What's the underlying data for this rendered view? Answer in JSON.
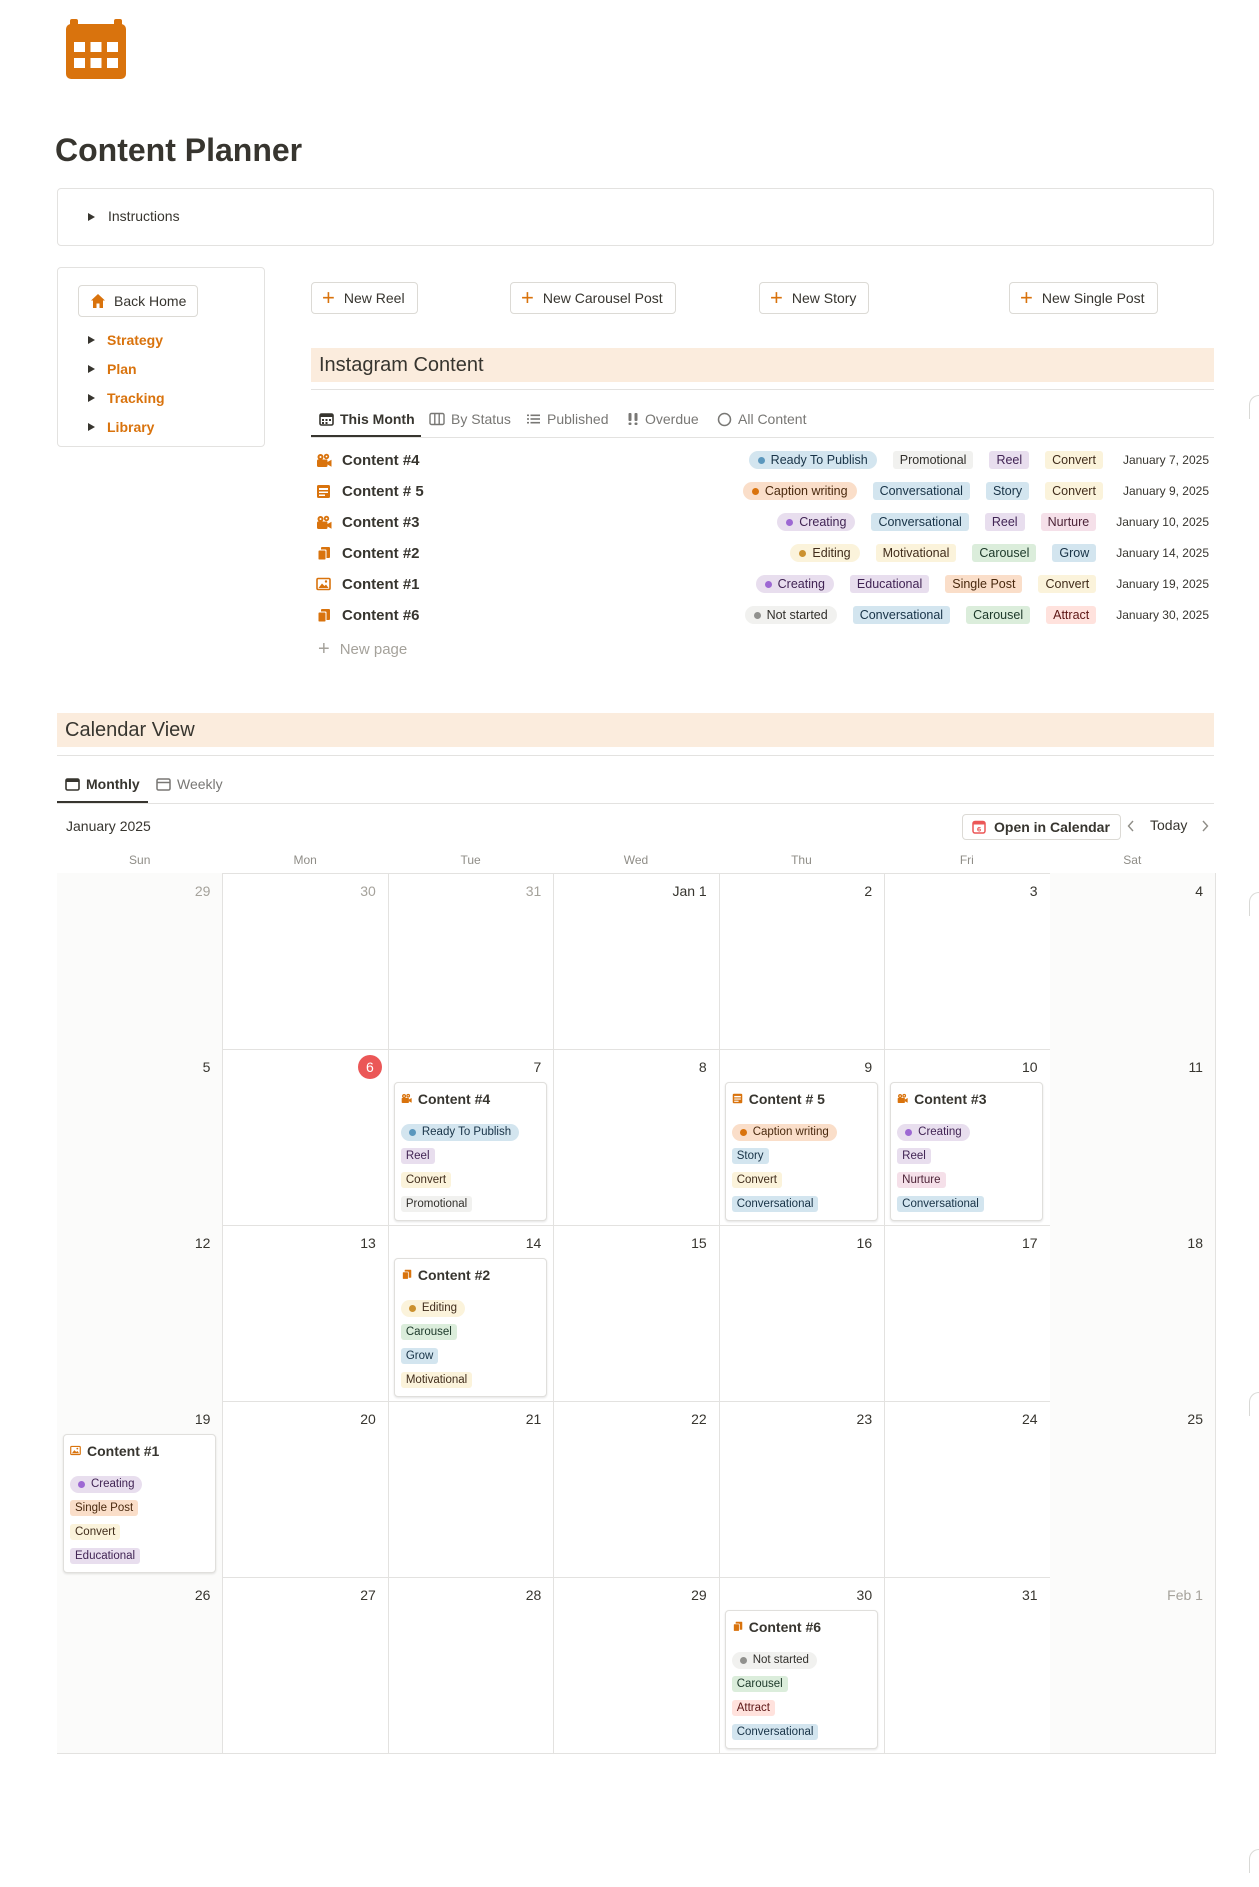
{
  "page": {
    "title": "Content Planner",
    "instructions_label": "Instructions"
  },
  "sidebar": {
    "home_label": "Back Home",
    "items": [
      "Strategy",
      "Plan",
      "Tracking",
      "Library"
    ]
  },
  "new_buttons": {
    "reel": "New Reel",
    "carousel": "New Carousel Post",
    "story": "New Story",
    "single": "New Single Post"
  },
  "instagram": {
    "heading": "Instagram Content",
    "tabs": [
      "This Month",
      "By Status",
      "Published",
      "Overdue",
      "All Content"
    ],
    "new_page_label": "New page",
    "rows": [
      {
        "name": "Content #4",
        "icon": "reel-icon",
        "status": "Ready To Publish",
        "status_color": "blue",
        "tags": [
          {
            "text": "Promotional",
            "color": "gray"
          },
          {
            "text": "Reel",
            "color": "purple"
          },
          {
            "text": "Convert",
            "color": "yellow"
          }
        ],
        "date": "January 7, 2025"
      },
      {
        "name": "Content # 5",
        "icon": "story-icon",
        "status": "Caption writing",
        "status_color": "orange",
        "tags": [
          {
            "text": "Conversational",
            "color": "blue"
          },
          {
            "text": "Story",
            "color": "blue"
          },
          {
            "text": "Convert",
            "color": "yellow"
          }
        ],
        "date": "January 9, 2025"
      },
      {
        "name": "Content #3",
        "icon": "reel-icon",
        "status": "Creating",
        "status_color": "purple",
        "tags": [
          {
            "text": "Conversational",
            "color": "blue"
          },
          {
            "text": "Reel",
            "color": "purple"
          },
          {
            "text": "Nurture",
            "color": "pink"
          }
        ],
        "date": "January 10, 2025"
      },
      {
        "name": "Content #2",
        "icon": "carousel-icon",
        "status": "Editing",
        "status_color": "yellow",
        "tags": [
          {
            "text": "Motivational",
            "color": "yellow"
          },
          {
            "text": "Carousel",
            "color": "green"
          },
          {
            "text": "Grow",
            "color": "blue"
          }
        ],
        "date": "January 14, 2025"
      },
      {
        "name": "Content #1",
        "icon": "image-icon",
        "status": "Creating",
        "status_color": "purple",
        "tags": [
          {
            "text": "Educational",
            "color": "purple"
          },
          {
            "text": "Single Post",
            "color": "orange"
          },
          {
            "text": "Convert",
            "color": "yellow"
          }
        ],
        "date": "January 19, 2025"
      },
      {
        "name": "Content #6",
        "icon": "carousel-icon",
        "status": "Not started",
        "status_color": "gray",
        "tags": [
          {
            "text": "Conversational",
            "color": "blue"
          },
          {
            "text": "Carousel",
            "color": "green"
          },
          {
            "text": "Attract",
            "color": "red"
          }
        ],
        "date": "January 30, 2025"
      }
    ]
  },
  "calendar": {
    "heading": "Calendar View",
    "tabs": [
      "Monthly",
      "Weekly"
    ],
    "month_label": "January 2025",
    "open_label": "Open in Calendar",
    "today_label": "Today",
    "weekdays": [
      "Sun",
      "Mon",
      "Tue",
      "Wed",
      "Thu",
      "Fri",
      "Sat"
    ],
    "days": [
      "29",
      "30",
      "31",
      "Jan 1",
      "2",
      "3",
      "4",
      "5",
      "6",
      "7",
      "8",
      "9",
      "10",
      "11",
      "12",
      "13",
      "14",
      "15",
      "16",
      "17",
      "18",
      "19",
      "20",
      "21",
      "22",
      "23",
      "24",
      "25",
      "26",
      "27",
      "28",
      "29",
      "30",
      "31",
      "Feb 1"
    ],
    "dim_days": [
      0,
      1,
      2,
      34
    ],
    "today_index": 8,
    "events": [
      {
        "day_index": 9,
        "title": "Content #4",
        "icon": "reel-icon",
        "status": "Ready To Publish",
        "status_color": "blue",
        "tags": [
          {
            "text": "Reel",
            "color": "purple"
          },
          {
            "text": "Convert",
            "color": "yellow"
          },
          {
            "text": "Promotional",
            "color": "gray"
          }
        ]
      },
      {
        "day_index": 11,
        "title": "Content # 5",
        "icon": "story-icon",
        "status": "Caption writing",
        "status_color": "orange",
        "tags": [
          {
            "text": "Story",
            "color": "blue"
          },
          {
            "text": "Convert",
            "color": "yellow"
          },
          {
            "text": "Conversational",
            "color": "blue"
          }
        ]
      },
      {
        "day_index": 12,
        "title": "Content #3",
        "icon": "reel-icon",
        "status": "Creating",
        "status_color": "purple",
        "tags": [
          {
            "text": "Reel",
            "color": "purple"
          },
          {
            "text": "Nurture",
            "color": "pink"
          },
          {
            "text": "Conversational",
            "color": "blue"
          }
        ]
      },
      {
        "day_index": 16,
        "title": "Content #2",
        "icon": "carousel-icon",
        "status": "Editing",
        "status_color": "yellow",
        "tags": [
          {
            "text": "Carousel",
            "color": "green"
          },
          {
            "text": "Grow",
            "color": "blue"
          },
          {
            "text": "Motivational",
            "color": "yellow"
          }
        ]
      },
      {
        "day_index": 21,
        "title": "Content #1",
        "icon": "image-icon",
        "status": "Creating",
        "status_color": "purple",
        "tags": [
          {
            "text": "Single Post",
            "color": "orange"
          },
          {
            "text": "Convert",
            "color": "yellow"
          },
          {
            "text": "Educational",
            "color": "purple"
          }
        ]
      },
      {
        "day_index": 32,
        "title": "Content #6",
        "icon": "carousel-icon",
        "status": "Not started",
        "status_color": "gray",
        "tags": [
          {
            "text": "Carousel",
            "color": "green"
          },
          {
            "text": "Attract",
            "color": "red"
          },
          {
            "text": "Conversational",
            "color": "blue"
          }
        ]
      }
    ]
  },
  "colors": {
    "accent": "#d9730d",
    "section_bg": "#fbecdd",
    "today_red": "#eb5757",
    "tag_bg": {
      "gray": "#f1f1ef",
      "blue": "#d3e5ef",
      "purple": "#e8deee",
      "yellow": "#fbf3db",
      "orange": "#fadec9",
      "green": "#dbeddb",
      "pink": "#f5e0e9",
      "red": "#ffe2dd"
    },
    "tag_fg": {
      "gray": "#32302c",
      "blue": "#183347",
      "purple": "#412454",
      "yellow": "#402c1b",
      "orange": "#49290e",
      "green": "#1c3829",
      "pink": "#4c2337",
      "red": "#5d1715"
    },
    "dot": {
      "gray": "#91918e",
      "blue": "#5b97bd",
      "purple": "#9d68d3",
      "yellow": "#cb912f",
      "orange": "#d9730d"
    }
  }
}
